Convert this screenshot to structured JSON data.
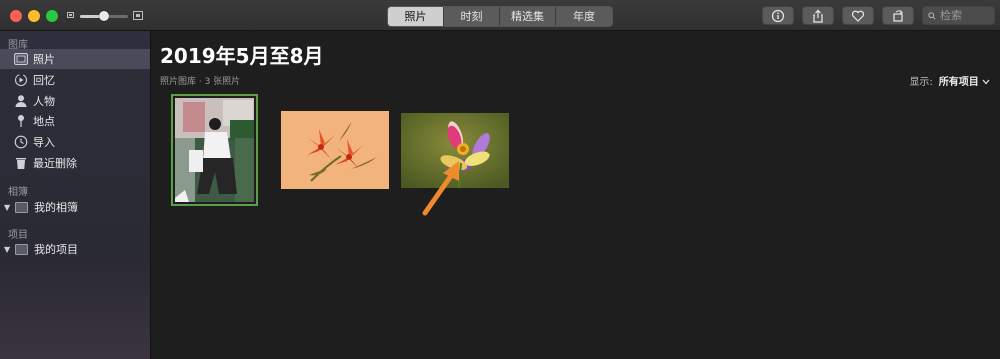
{
  "toolbar": {
    "tabs": [
      {
        "label": "照片",
        "active": true
      },
      {
        "label": "时刻",
        "active": false
      },
      {
        "label": "精选集",
        "active": false
      },
      {
        "label": "年度",
        "active": false
      }
    ],
    "search_placeholder": "检索",
    "buttons": [
      "info-icon",
      "share-icon",
      "heart-icon",
      "rotate-icon"
    ],
    "zoom_level": 0.5
  },
  "sidebar": {
    "library_title": "图库",
    "library_items": [
      {
        "label": "照片",
        "icon": "photos-icon",
        "selected": true
      },
      {
        "label": "回忆",
        "icon": "memories-icon",
        "selected": false
      },
      {
        "label": "人物",
        "icon": "people-icon",
        "selected": false
      },
      {
        "label": "地点",
        "icon": "places-icon",
        "selected": false
      },
      {
        "label": "导入",
        "icon": "import-icon",
        "selected": false
      },
      {
        "label": "最近删除",
        "icon": "trash-icon",
        "selected": false
      }
    ],
    "albums_title": "相簿",
    "albums_item": "我的相簿",
    "projects_title": "项目",
    "projects_item": "我的项目"
  },
  "main": {
    "title": "2019年5月至8月",
    "subtitle": "照片图库 · 3 张照片",
    "showing_label": "显示:",
    "showing_value": "所有项目"
  },
  "colors": {
    "accent_selected_border": "#5aa04a",
    "arrow": "#f08a2a",
    "segment_active": "#cfcfcf"
  }
}
